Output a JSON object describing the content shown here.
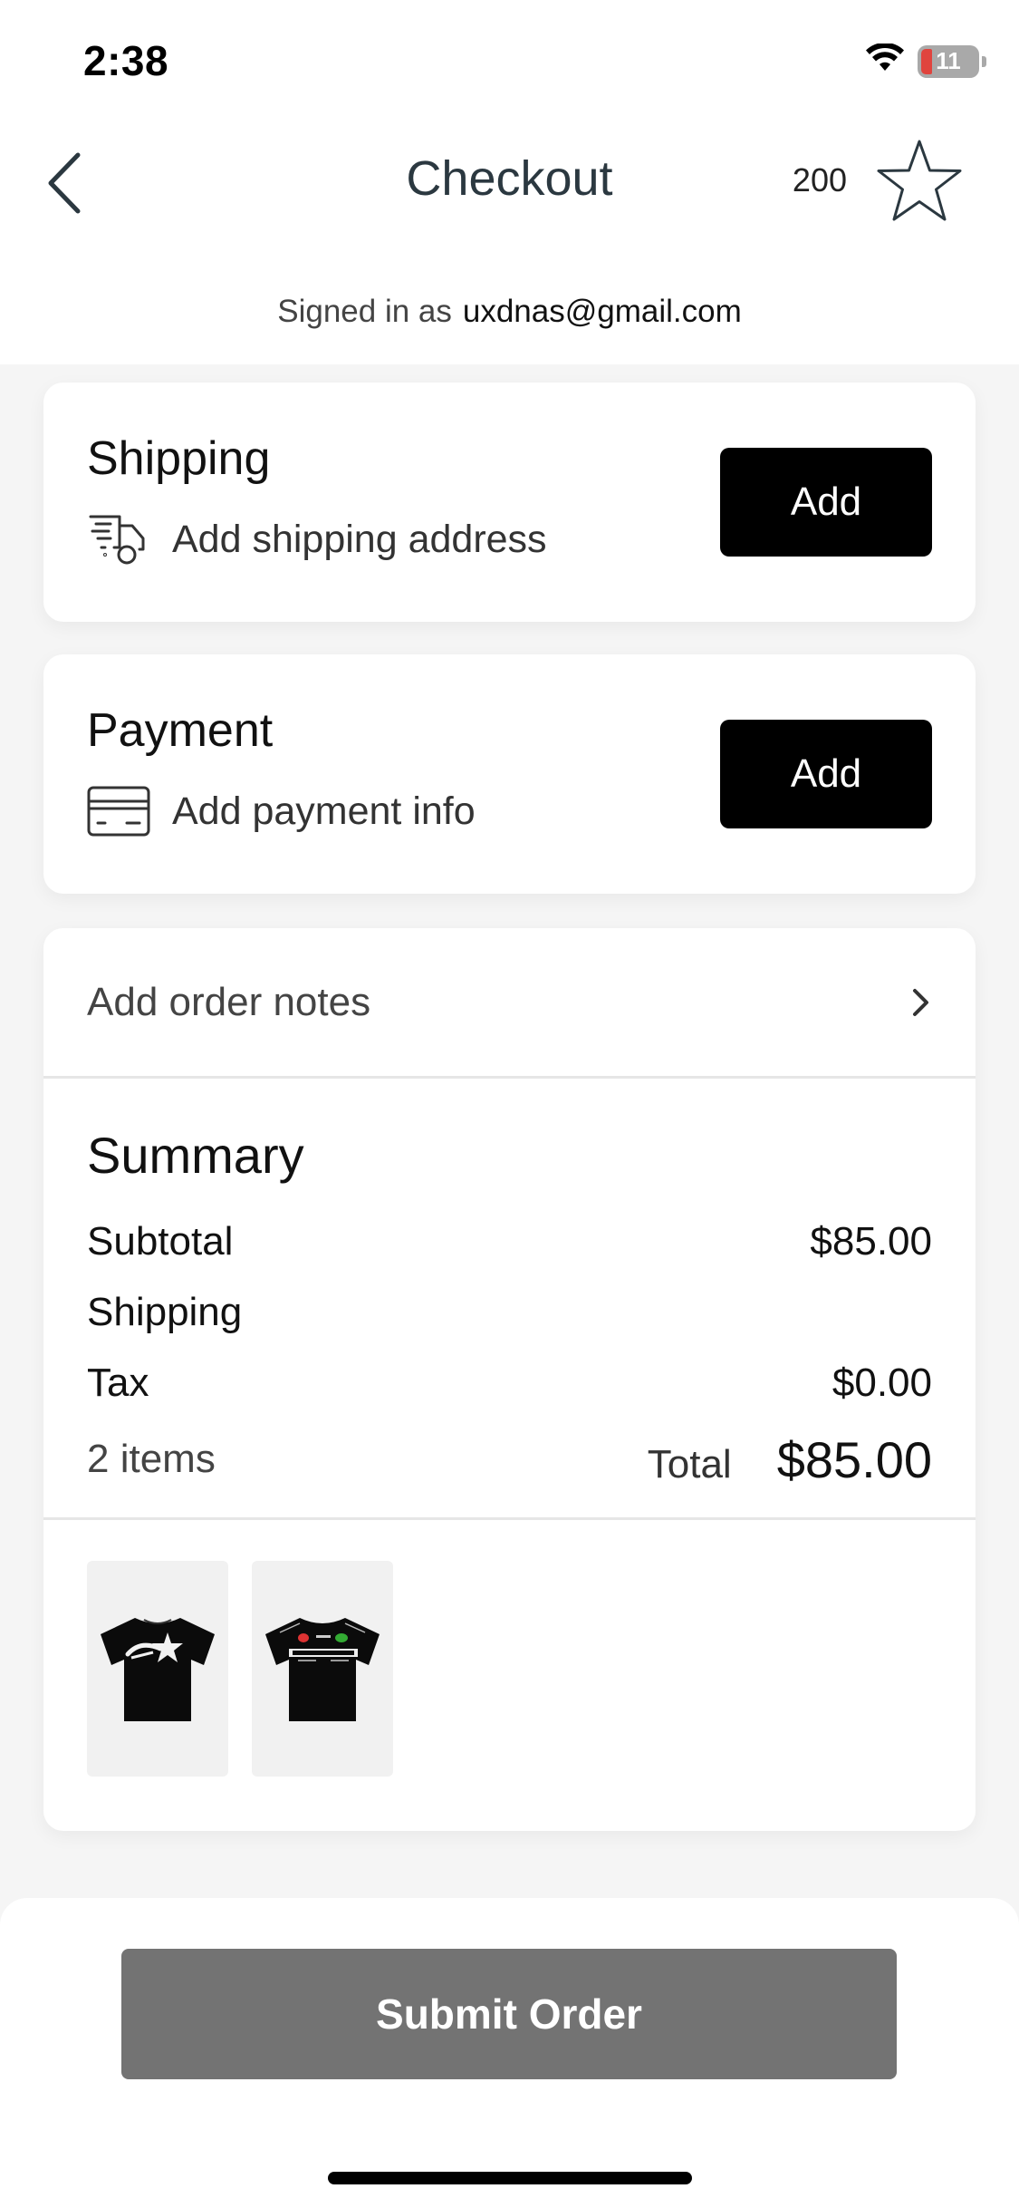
{
  "status_bar": {
    "time": "2:38",
    "battery_level": "11"
  },
  "header": {
    "title": "Checkout",
    "points": "200",
    "signed_in_label": "Signed in as",
    "email": "uxdnas@gmail.com"
  },
  "shipping": {
    "title": "Shipping",
    "subtitle": "Add shipping address",
    "button_label": "Add",
    "icon": "delivery-truck-icon"
  },
  "payment": {
    "title": "Payment",
    "subtitle": "Add payment info",
    "button_label": "Add",
    "icon": "credit-card-icon"
  },
  "order_notes": {
    "label": "Add order notes"
  },
  "summary": {
    "title": "Summary",
    "subtotal_label": "Subtotal",
    "subtotal_value": "$85.00",
    "shipping_label": "Shipping",
    "shipping_value": "",
    "tax_label": "Tax",
    "tax_value": "$0.00",
    "items_count": "2 items",
    "total_label": "Total",
    "total_value": "$85.00"
  },
  "items": [
    {
      "name": "black-tshirt-star-graphic",
      "color": "#0b0b0b"
    },
    {
      "name": "black-tshirt-racing-graphic",
      "color": "#0b0b0b"
    }
  ],
  "footer": {
    "submit_label": "Submit Order"
  },
  "colors": {
    "primary_button": "#000000",
    "submit_button_disabled": "#737373",
    "background": "#f5f5f5",
    "title_text": "#2b3840"
  }
}
